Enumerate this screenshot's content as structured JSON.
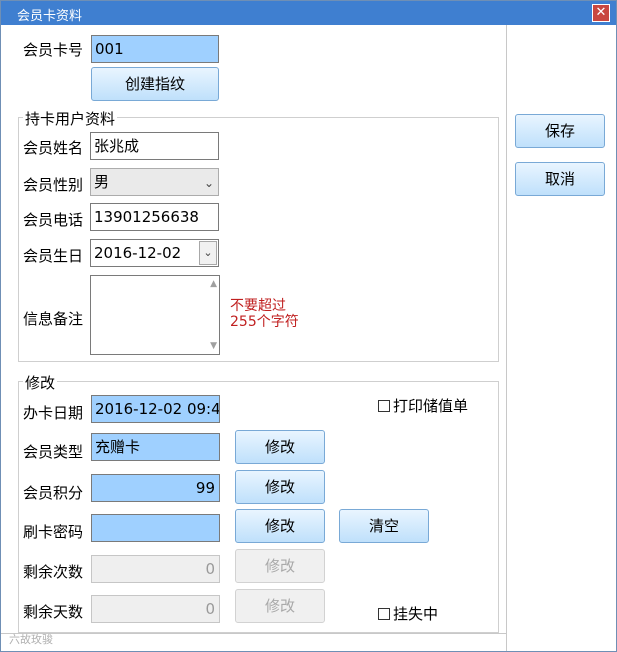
{
  "window": {
    "title": "会员卡资料",
    "close_glyph": "✕"
  },
  "card": {
    "number_label": "会员卡号",
    "number_value": "001",
    "create_fingerprint_button": "创建指纹"
  },
  "holder": {
    "group_title": "持卡用户资料",
    "name_label": "会员姓名",
    "name_value": "张兆成",
    "gender_label": "会员性别",
    "gender_value": "男",
    "phone_label": "会员电话",
    "phone_value": "13901256638",
    "birthday_label": "会员生日",
    "birthday_value": "2016-12-02",
    "remark_label": "信息备注",
    "remark_hint_line1": "不要超过",
    "remark_hint_line2": "255个字符"
  },
  "modify": {
    "group_title": "修改",
    "open_date_label": "办卡日期",
    "open_date_value": "2016-12-02  09:4",
    "print_stored_value_label": "打印储值单",
    "type_label": "会员类型",
    "type_value": "充赠卡",
    "points_label": "会员积分",
    "points_value": "99",
    "password_label": "刷卡密码",
    "password_value": "",
    "remaining_times_label": "剩余次数",
    "remaining_times_value": "0",
    "remaining_days_label": "剩余天数",
    "remaining_days_value": "0",
    "modify_button": "修改",
    "clear_button": "清空",
    "lost_label": "挂失中"
  },
  "actions": {
    "save_button": "保存",
    "cancel_button": "取消"
  },
  "watermark": "六故玫骏"
}
